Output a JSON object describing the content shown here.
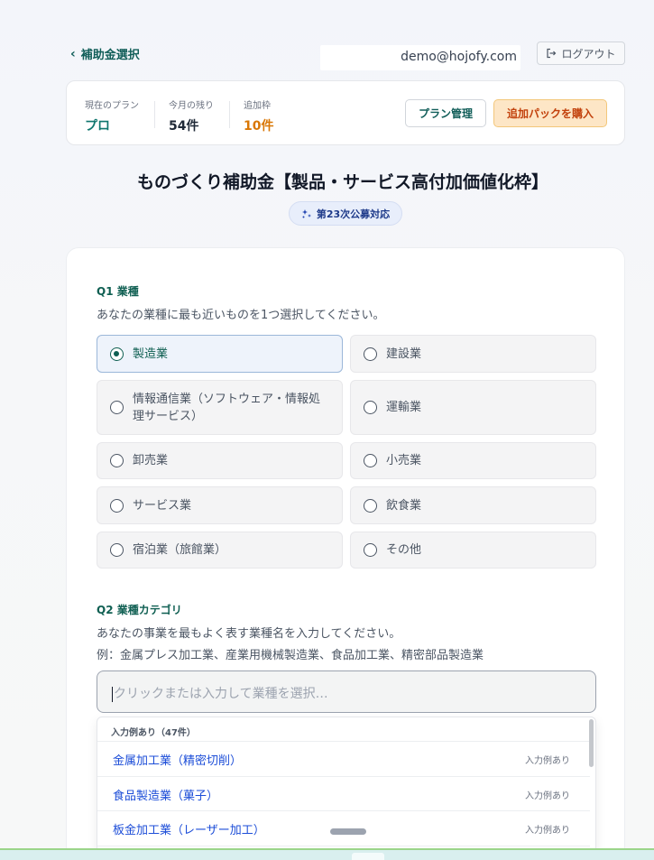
{
  "header": {
    "back_label": "補助金選択",
    "email": "demo@hojofy.com",
    "logout_label": "ログアウト"
  },
  "plan": {
    "current_plan_label": "現在のプラン",
    "current_plan_value": "プロ",
    "remaining_label": "今月の残り",
    "remaining_value": "54件",
    "extra_label": "追加枠",
    "extra_value": "10件",
    "manage_button": "プラン管理",
    "buy_button": "追加パックを購入",
    "colors": {
      "plan": "#0f766e",
      "extra": "#d97706"
    }
  },
  "page": {
    "title": "ものづくり補助金【製品・サービス高付加価値化枠】",
    "badge": "第23次公募対応"
  },
  "q1": {
    "title": "Q1  業種",
    "description": "あなたの業種に最も近いものを1つ選択してください。",
    "options": [
      {
        "label": "製造業",
        "selected": true
      },
      {
        "label": "建設業",
        "selected": false
      },
      {
        "label": "情報通信業（ソフトウェア・情報処理サービス）",
        "selected": false
      },
      {
        "label": "運輸業",
        "selected": false
      },
      {
        "label": "卸売業",
        "selected": false
      },
      {
        "label": "小売業",
        "selected": false
      },
      {
        "label": "サービス業",
        "selected": false
      },
      {
        "label": "飲食業",
        "selected": false
      },
      {
        "label": "宿泊業（旅館業）",
        "selected": false
      },
      {
        "label": "その他",
        "selected": false
      }
    ]
  },
  "q2": {
    "title": "Q2  業種カテゴリ",
    "description": "あなたの事業を最もよく表す業種名を入力してください。",
    "example": "例：金属プレス加工業、産業用機械製造業、食品加工業、精密部品製造業",
    "placeholder": "クリックまたは入力して業種を選択…",
    "dropdown_header": "入力例あり（47件）",
    "suggestions": [
      {
        "name": "金属加工業（精密切削）",
        "tag": "入力例あり"
      },
      {
        "name": "食品製造業（菓子）",
        "tag": "入力例あり"
      },
      {
        "name": "板金加工業（レーザー加工）",
        "tag": "入力例あり"
      }
    ]
  }
}
